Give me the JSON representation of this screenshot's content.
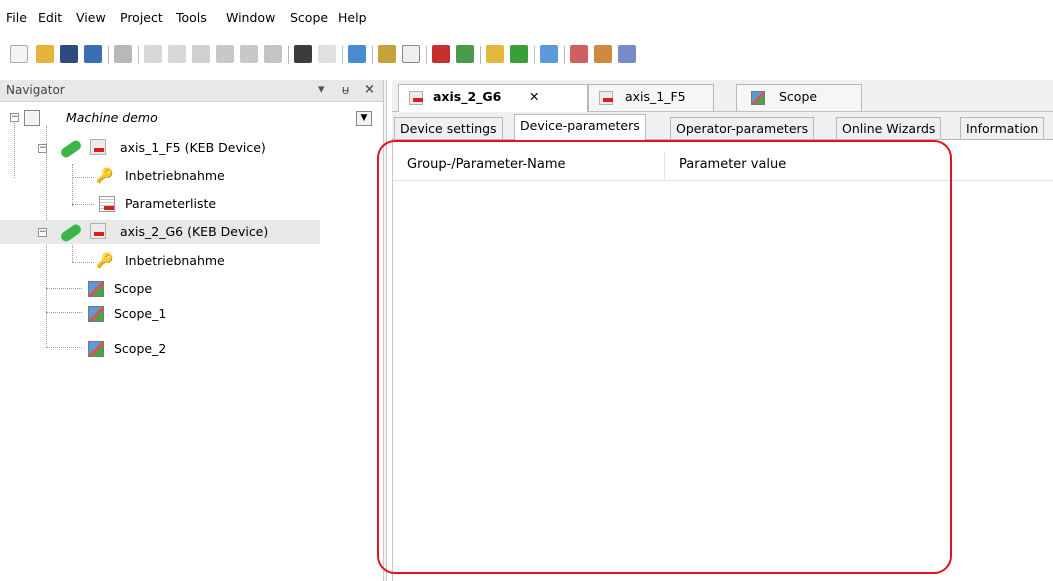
{
  "menu": [
    "File",
    "Edit",
    "View",
    "Project",
    "Tools",
    "Window",
    "Scope",
    "Help"
  ],
  "navigator": {
    "title": "Navigator",
    "pin": "▾  ᵾ",
    "close": "×",
    "tree": {
      "root": "Machine demo",
      "axis1": "axis_1_F5 (KEB Device)",
      "axis1_child1": "Inbetriebnahme",
      "axis1_child2": "Parameterliste",
      "axis2": "axis_2_G6 (KEB Device)",
      "axis2_child1": "Inbetriebnahme",
      "scope": "Scope",
      "scope1": "Scope_1",
      "scope2": "Scope_2"
    }
  },
  "doc_tabs": [
    {
      "label": "axis_2_G6",
      "close": "✕"
    },
    {
      "label": "axis_1_F5"
    },
    {
      "label": "Scope"
    }
  ],
  "sub_tabs": [
    "Device settings",
    "Device-parameters",
    "Operator-parameters",
    "Online Wizards",
    "Information"
  ],
  "grid": {
    "col1": "Group-/Parameter-Name",
    "col2": "Parameter value"
  },
  "colors": {
    "highlight": "#e0141e",
    "keb_red": "#d81e1e",
    "plug_green": "#3bb54a"
  }
}
